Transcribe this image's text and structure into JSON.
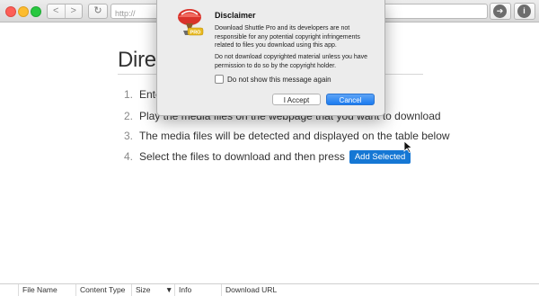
{
  "browser": {
    "back_glyph": "<",
    "forward_glyph": ">",
    "reload_glyph": "↻",
    "url": "http://",
    "go_glyph": "➔",
    "info_glyph": "i"
  },
  "content": {
    "heading": "Direc",
    "steps": [
      {
        "num": "1.",
        "text": "Ente"
      },
      {
        "num": "2.",
        "text": "Play the media files on the webpage that you want to download"
      },
      {
        "num": "3.",
        "text": "The media files will be detected and displayed on the table below"
      },
      {
        "num": "4.",
        "text": "Select the files to download and then press"
      }
    ],
    "add_selected_label": "Add Selected"
  },
  "table": {
    "columns": [
      "File Name",
      "Content Type",
      "Size",
      "Info",
      "Download URL"
    ],
    "sort_indicator": "▼"
  },
  "dialog": {
    "title": "Disclaimer",
    "paragraph1": "Download Shuttle Pro and its developers are not responsible for any potential copyright infringements related to files you download using this app.",
    "paragraph2": "Do not download copyrighted material unless you have permission to do so by the copyright holder.",
    "checkbox_label": "Do not show this message again",
    "accept_label": "I Accept",
    "cancel_label": "Cancel",
    "icon_badge": "PRO"
  },
  "colors": {
    "accent": "#1577d4",
    "cancel_button": "#1b7bf0"
  }
}
